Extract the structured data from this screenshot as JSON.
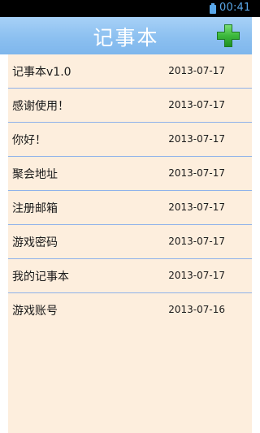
{
  "status_bar": {
    "time": "00:41",
    "battery_icon": "battery-icon"
  },
  "header": {
    "title": "记事本",
    "add_icon": "plus-icon",
    "accent_color": "#8cc0f0"
  },
  "notes": [
    {
      "title": "记事本v1.0",
      "date": "2013-07-17"
    },
    {
      "title": "感谢使用！",
      "date": "2013-07-17"
    },
    {
      "title": "你好！",
      "date": "2013-07-17"
    },
    {
      "title": "聚会地址",
      "date": "2013-07-17"
    },
    {
      "title": "注册邮箱",
      "date": "2013-07-17"
    },
    {
      "title": "游戏密码",
      "date": "2013-07-17"
    },
    {
      "title": "我的记事本",
      "date": "2013-07-17"
    },
    {
      "title": "游戏账号",
      "date": "2013-07-16"
    }
  ],
  "colors": {
    "list_background": "#fdeedd",
    "divider": "#8fb2ea",
    "add_green": "#3cb83c"
  }
}
